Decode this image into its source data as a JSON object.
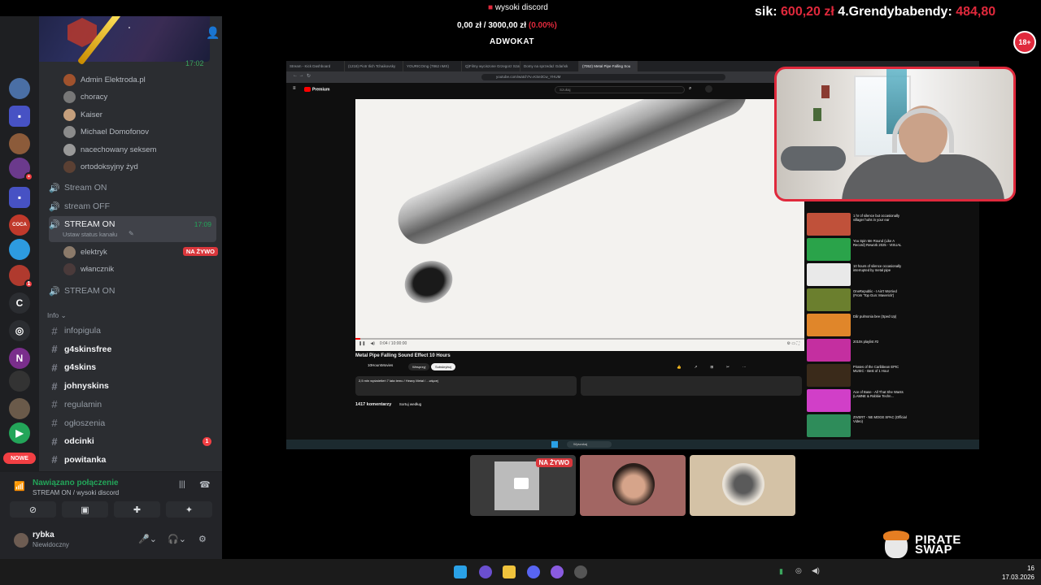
{
  "overlay": {
    "top_title": "wysoki discord",
    "progress_current": "0,00 zł",
    "progress_total": " / 3000,00 zł ",
    "progress_percent": "(0.00%)",
    "goal_label": "ADWOKAT",
    "donor1_name": "sik: ",
    "donor1_amount": "600,20 zł",
    "donor2_name": " 4.Grendybabendy: ",
    "donor2_amount": "484,80",
    "age_badge": "18+",
    "sponsor_line1": "PIRATE",
    "sponsor_line2": "SWAP"
  },
  "discord": {
    "banner_time": "17:02",
    "members_top": [
      {
        "name": "Admin Elektroda.pl",
        "color": "#a0522d"
      },
      {
        "name": "choracy",
        "color": "#777"
      },
      {
        "name": "Kaiser",
        "color": "#c59f7c"
      },
      {
        "name": "Michael Domofonov",
        "color": "#8b8b8b"
      },
      {
        "name": "nacechowany seksem",
        "color": "#999"
      },
      {
        "name": "ortodoksyjny żyd",
        "color": "#5b4033"
      }
    ],
    "voice_channels": [
      {
        "name": "Stream ON"
      },
      {
        "name": "stream OFF"
      }
    ],
    "active_channel": {
      "name": "STREAM ON",
      "time": "17:09",
      "status_placeholder": "Ustaw status kanału"
    },
    "active_members": [
      {
        "name": "elektryk",
        "badge": "NA ŻYWO"
      },
      {
        "name": "włancznik",
        "badge": ""
      }
    ],
    "voice_channel_4": "STREAM ON",
    "category": "Info",
    "text_channels": [
      {
        "name": "infopigula",
        "bold": false,
        "badge": ""
      },
      {
        "name": "g4skinsfree",
        "bold": true,
        "badge": ""
      },
      {
        "name": "g4skins",
        "bold": true,
        "badge": ""
      },
      {
        "name": "johnyskins",
        "bold": true,
        "badge": ""
      },
      {
        "name": "regulamin",
        "bold": false,
        "badge": ""
      },
      {
        "name": "ogłoszenia",
        "bold": false,
        "badge": ""
      },
      {
        "name": "odcinki",
        "bold": true,
        "badge": "1"
      },
      {
        "name": "powitanka",
        "bold": true,
        "badge": ""
      }
    ],
    "server_letter": "C",
    "nowe_badge": "NOWE",
    "voice_status": "Nawiązano połączenie",
    "voice_sub": "STREAM ON / wysoki discord",
    "username": "rybka",
    "user_status": "Niewidoczny"
  },
  "browser": {
    "tabs": [
      "Stream - Kick Dashboard",
      "(1218) Piotr Ilich Tchaikovsky",
      "YOURICOmg (7862 nMX)",
      "Q)Filmy wyciszone Grzegorz Szaf",
      "Domy na sprzedaż Gdańsk",
      "(7052) Metal Pipe Falling Sou"
    ],
    "url": "youtube.com/watch?v=KSe3Cw_YHUM",
    "yt_logo": "Premium",
    "search_placeholder": "Szukaj",
    "video_title": "Metal Pipe Falling Sound Effect 10 Hours",
    "channel": "10HoursMovies",
    "join_label": "Wesprzyj",
    "sub_label": "Subskrybuj",
    "description": "2,5 mln wyświetleń  7 lata temu / Heavy Metal / ...więcej",
    "comments": "1417 komentarzy",
    "sort_label": "Sortuj według",
    "timestamp": "0:04 / 10:00:00",
    "sidebar": [
      {
        "title": "1 hr of silence but occasionally villager huhs in your ear",
        "color": "#c0513a"
      },
      {
        "title": "You Spin Me Round (Like A Record) Rework 2025 - VISUAL",
        "color": "#2aa34a"
      },
      {
        "title": "10 hours of silence occasionally interrupted by metal pipe",
        "color": "#e9e9e9"
      },
      {
        "title": "OneRepublic - I Ain't Worried (From 'Top Gun: Maverick')",
        "color": "#6b7f2e"
      },
      {
        "title": "Dår pulmonia bee (Sped Up)",
        "color": "#e0862a"
      },
      {
        "title": "2010s playlist #2",
        "color": "#c42fa0"
      },
      {
        "title": "Pirates of the Caribbean EPIC MUSIC - Best of 1 Hour",
        "color": "#3a2a1a"
      },
      {
        "title": "Ace of Base - All That She Wants (LAMNE & Robbie Techn...",
        "color": "#d13fc8"
      },
      {
        "title": "ZIVERT - NE MOGE SPAC (Official Video)",
        "color": "#2e8c5a"
      }
    ],
    "win_search": "Wyszukaj"
  },
  "tiles": {
    "live_label": "NA ŻYWO"
  },
  "taskbar": {
    "time": "16",
    "date": "17.03.2026"
  }
}
